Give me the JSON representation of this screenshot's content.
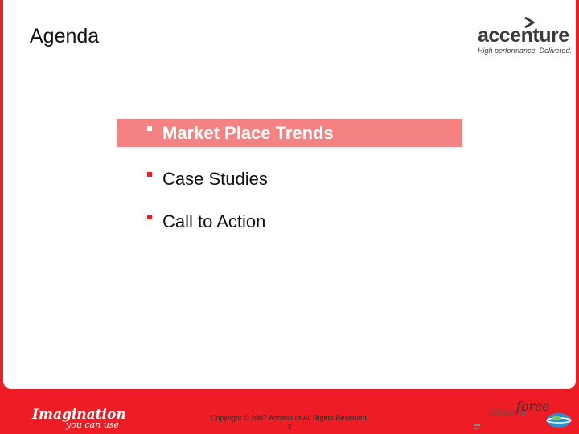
{
  "slide": {
    "title": "Agenda"
  },
  "logo": {
    "wordmark": "accenture",
    "tagline": "High performance. Delivered.",
    "icon": "chevron-icon"
  },
  "agenda": {
    "items": [
      {
        "label": "Market Place Trends",
        "active": true
      },
      {
        "label": "Case Studies",
        "active": false
      },
      {
        "label": "Call to Action",
        "active": false
      }
    ]
  },
  "footer": {
    "brand_line1": "Imagination",
    "brand_line2": "you can use",
    "copyright": "Copyright © 2007 Accenture All Rights Reserved.",
    "page_number": "3",
    "event_logo": {
      "dream": "dream",
      "force": "force",
      "year": "07",
      "icons": [
        "lightbulb-icon",
        "globe-icon"
      ]
    }
  },
  "colors": {
    "accent_red": "#ee1c25",
    "highlight_pink": "#f58282",
    "text_dark": "#111111"
  }
}
